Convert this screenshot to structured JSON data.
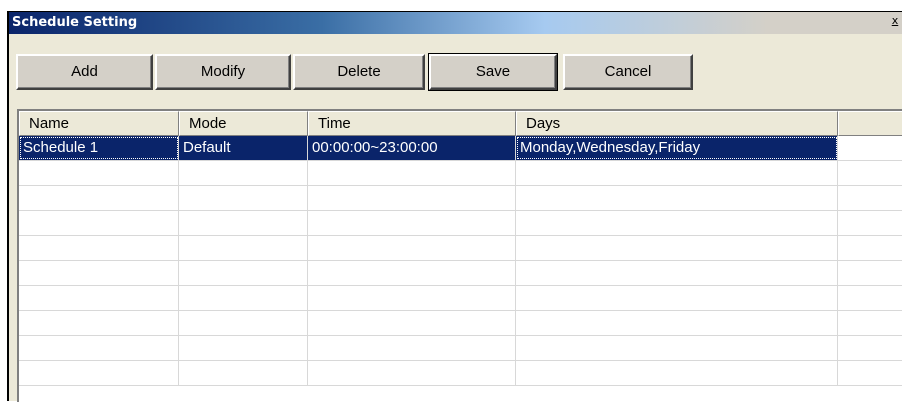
{
  "window": {
    "title": "Schedule Setting",
    "close_glyph": "x"
  },
  "toolbar": {
    "add_label": "Add",
    "modify_label": "Modify",
    "delete_label": "Delete",
    "save_label": "Save",
    "cancel_label": "Cancel"
  },
  "table": {
    "columns": [
      "Name",
      "Mode",
      "Time",
      "Days",
      ""
    ],
    "rows": [
      {
        "name": "Schedule 1",
        "mode": "Default",
        "time": "00:00:00~23:00:00",
        "days": "Monday,Wednesday,Friday",
        "selected": true
      }
    ],
    "empty_row_count": 9
  },
  "colors": {
    "selection": "#0a246a",
    "face": "#ece9d8"
  }
}
